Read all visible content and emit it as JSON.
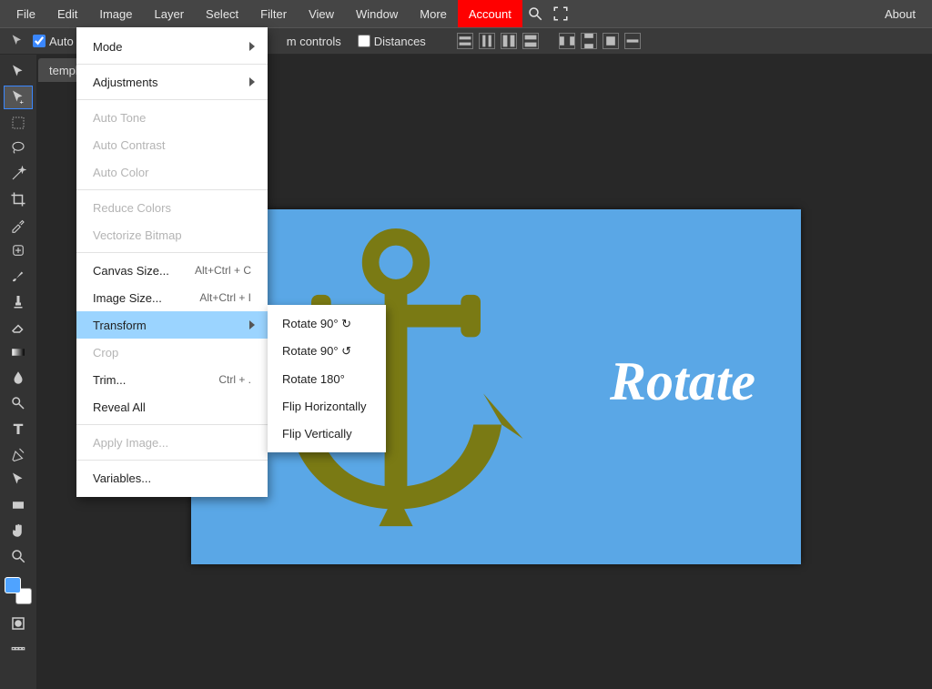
{
  "menubar": {
    "items": [
      "File",
      "Edit",
      "Image",
      "Layer",
      "Select",
      "Filter",
      "View",
      "Window",
      "More",
      "Account"
    ],
    "right": "About"
  },
  "options": {
    "auto_label": "Auto",
    "controls_label": "m controls",
    "distances_label": "Distances"
  },
  "tab": {
    "title": "templ"
  },
  "canvas": {
    "word": "Rotate"
  },
  "image_menu": {
    "mode": "Mode",
    "adjustments": "Adjustments",
    "auto_tone": "Auto Tone",
    "auto_contrast": "Auto Contrast",
    "auto_color": "Auto Color",
    "reduce_colors": "Reduce Colors",
    "vectorize": "Vectorize Bitmap",
    "canvas_size": "Canvas Size...",
    "canvas_size_sc": "Alt+Ctrl + C",
    "image_size": "Image Size...",
    "image_size_sc": "Alt+Ctrl + I",
    "transform": "Transform",
    "crop": "Crop",
    "trim": "Trim...",
    "trim_sc": "Ctrl + .",
    "reveal_all": "Reveal All",
    "apply_image": "Apply Image...",
    "variables": "Variables..."
  },
  "transform_sub": {
    "r90cw": "Rotate 90° ↻",
    "r90ccw": "Rotate 90° ↺",
    "r180": "Rotate 180°",
    "fliph": "Flip Horizontally",
    "flipv": "Flip Vertically"
  }
}
